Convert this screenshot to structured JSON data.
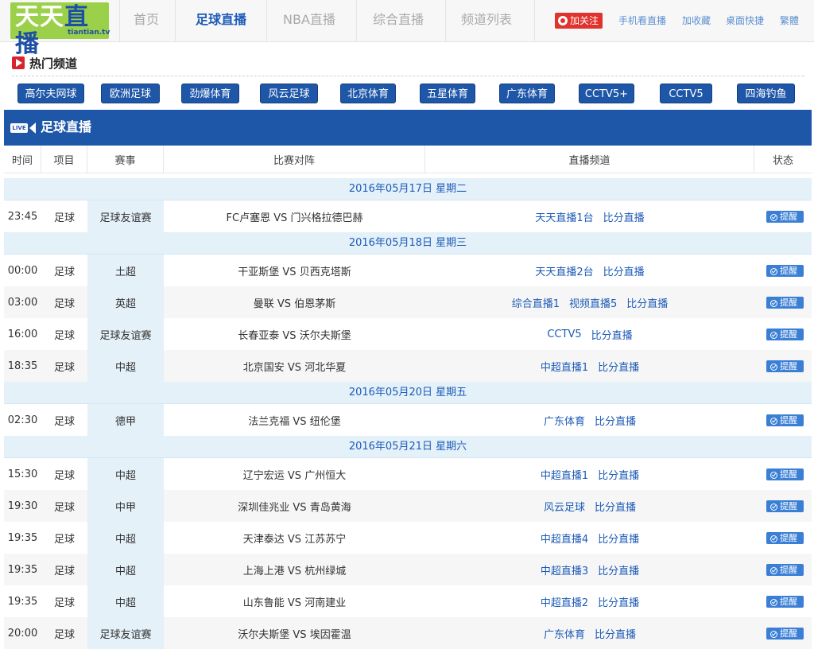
{
  "header": {
    "logo": {
      "text_a": "天天",
      "text_b": "直播",
      "sub": "tiantian.tv"
    },
    "nav": [
      "首页",
      "足球直播",
      "NBA直播",
      "综合直播",
      "频道列表"
    ],
    "active_nav": 1,
    "weibo_label": "加关注",
    "links": [
      "手机看直播",
      "加收藏",
      "桌面快捷",
      "繁體"
    ]
  },
  "hot": {
    "title": "热门频道",
    "channels": [
      "高尔夫网球",
      "欧洲足球",
      "劲爆体育",
      "风云足球",
      "北京体育",
      "五星体育",
      "广东体育",
      "CCTV5+",
      "CCTV5",
      "四海钓鱼"
    ]
  },
  "section": {
    "live_badge": "LIVE",
    "title": "足球直播"
  },
  "table": {
    "headers": [
      "时间",
      "项目",
      "赛事",
      "比赛对阵",
      "直播频道",
      "状态"
    ],
    "remind_label": "提醒",
    "groups": [
      {
        "date": "2016年05月17日 星期二",
        "matches": [
          {
            "time": "23:45",
            "sport": "足球",
            "league": "足球友谊赛",
            "match": "FC卢塞恩 VS 门兴格拉德巴赫",
            "channels": [
              "天天直播1台",
              "比分直播"
            ]
          }
        ]
      },
      {
        "date": "2016年05月18日 星期三",
        "matches": [
          {
            "time": "00:00",
            "sport": "足球",
            "league": "土超",
            "match": "干亚斯堡 VS 贝西克塔斯",
            "channels": [
              "天天直播2台",
              "比分直播"
            ]
          },
          {
            "time": "03:00",
            "sport": "足球",
            "league": "英超",
            "match": "曼联 VS 伯恩茅斯",
            "channels": [
              "综合直播1",
              "视频直播5",
              "比分直播"
            ]
          },
          {
            "time": "16:00",
            "sport": "足球",
            "league": "足球友谊赛",
            "match": "长春亚泰 VS 沃尔夫斯堡",
            "channels": [
              "CCTV5",
              "比分直播"
            ]
          },
          {
            "time": "18:35",
            "sport": "足球",
            "league": "中超",
            "match": "北京国安 VS 河北华夏",
            "channels": [
              "中超直播1",
              "比分直播"
            ]
          }
        ]
      },
      {
        "date": "2016年05月20日 星期五",
        "matches": [
          {
            "time": "02:30",
            "sport": "足球",
            "league": "德甲",
            "match": "法兰克福 VS 纽伦堡",
            "channels": [
              "广东体育",
              "比分直播"
            ]
          }
        ]
      },
      {
        "date": "2016年05月21日 星期六",
        "matches": [
          {
            "time": "15:30",
            "sport": "足球",
            "league": "中超",
            "match": "辽宁宏运 VS 广州恒大",
            "channels": [
              "中超直播1",
              "比分直播"
            ]
          },
          {
            "time": "19:30",
            "sport": "足球",
            "league": "中甲",
            "match": "深圳佳兆业 VS 青岛黄海",
            "channels": [
              "风云足球",
              "比分直播"
            ]
          },
          {
            "time": "19:35",
            "sport": "足球",
            "league": "中超",
            "match": "天津泰达 VS 江苏苏宁",
            "channels": [
              "中超直播4",
              "比分直播"
            ]
          },
          {
            "time": "19:35",
            "sport": "足球",
            "league": "中超",
            "match": "上海上港 VS 杭州绿城",
            "channels": [
              "中超直播3",
              "比分直播"
            ]
          },
          {
            "time": "19:35",
            "sport": "足球",
            "league": "中超",
            "match": "山东鲁能 VS 河南建业",
            "channels": [
              "中超直播2",
              "比分直播"
            ]
          },
          {
            "time": "20:00",
            "sport": "足球",
            "league": "足球友谊赛",
            "match": "沃尔夫斯堡 VS 埃因霍温",
            "channels": [
              "广东体育",
              "比分直播"
            ]
          }
        ]
      }
    ]
  }
}
